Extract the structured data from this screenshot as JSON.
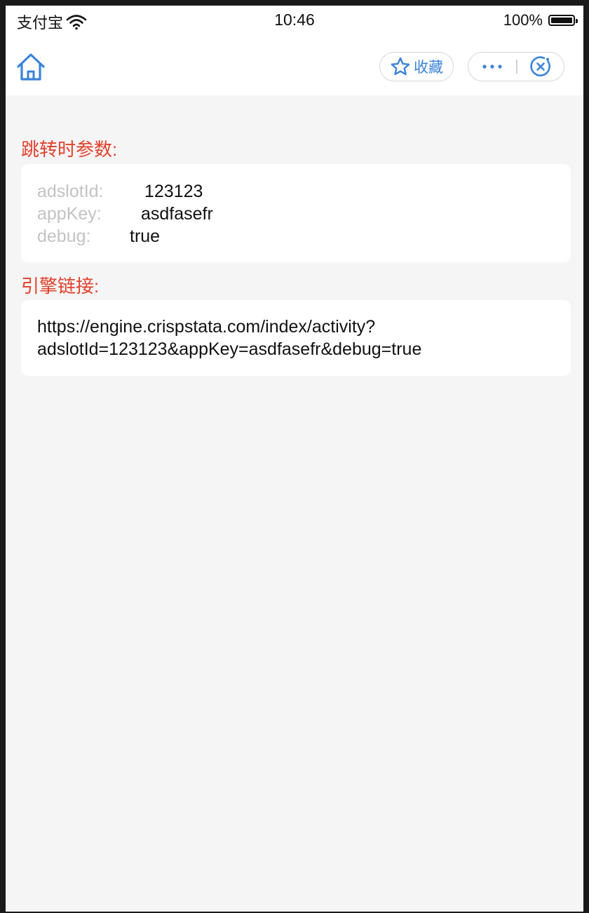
{
  "status_bar": {
    "carrier": "支付宝",
    "time": "10:46",
    "battery": "100%"
  },
  "nav": {
    "favorite_label": "收藏",
    "more_label": "···"
  },
  "params_section": {
    "title": "跳转时参数:",
    "rows": [
      {
        "key": "adslotId:",
        "value": "123123"
      },
      {
        "key": "appKey:",
        "value": "asdfasefr"
      },
      {
        "key": "debug:",
        "value": "true"
      }
    ]
  },
  "link_section": {
    "title": "引擎链接:",
    "line1": "https://engine.crispstata.com/index/activity?",
    "line2": "adslotId=123123&appKey=asdfasefr&debug=true"
  },
  "colors": {
    "accent": "#3a83d9",
    "title_red": "#e2402c",
    "key_gray": "#c3c3c3",
    "background": "#f5f5f5"
  }
}
